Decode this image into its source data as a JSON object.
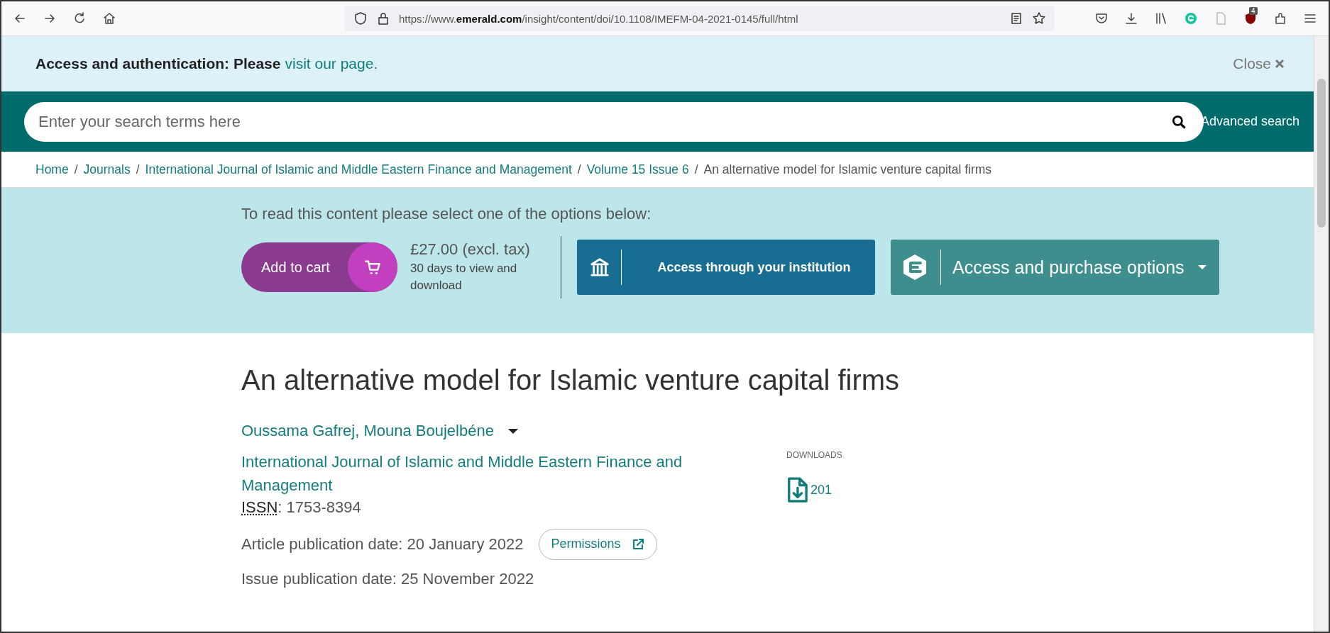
{
  "browser": {
    "url": "https://www.**emerald.com**/insight/content/doi/10.1108/IMEFM-04-2021-0145/full/html",
    "extension_badge": "4"
  },
  "banner": {
    "text": "Access and authentication: Please",
    "link": "visit our page.",
    "close": "Close"
  },
  "search": {
    "placeholder": "Enter your search terms here",
    "advanced": "Advanced search"
  },
  "breadcrumb_separator": "/",
  "breadcrumb": [
    {
      "label": "Home",
      "kind": "link"
    },
    {
      "label": "Journals",
      "kind": "link"
    },
    {
      "label": "International Journal of Islamic and Middle Eastern Finance and Management",
      "kind": "link"
    },
    {
      "label": "Volume 15 Issue 6",
      "kind": "link"
    },
    {
      "label": "An alternative model for Islamic venture capital firms",
      "kind": "current"
    }
  ],
  "purchase": {
    "prompt": "To read this content please select one of the options below:",
    "cart_button": "Add to cart",
    "price": "£27.00 (excl. tax)",
    "price_note": "30 days to view and download",
    "institution_button": "Access through your institution",
    "options_button": "Access and purchase options"
  },
  "article": {
    "title": "An alternative model for Islamic venture capital firms",
    "authors": "Oussama Gafrej, Mouna Boujelbéne",
    "journal": "International Journal of Islamic and Middle Eastern Finance and Management",
    "issn_label": "ISSN",
    "issn": ": 1753-8394",
    "article_date": "Article publication date: 20 January 2022",
    "permissions": "Permissions",
    "issue_date": "Issue publication date: 25 November 2022",
    "downloads_label": "DOWNLOADS",
    "downloads": "201"
  }
}
